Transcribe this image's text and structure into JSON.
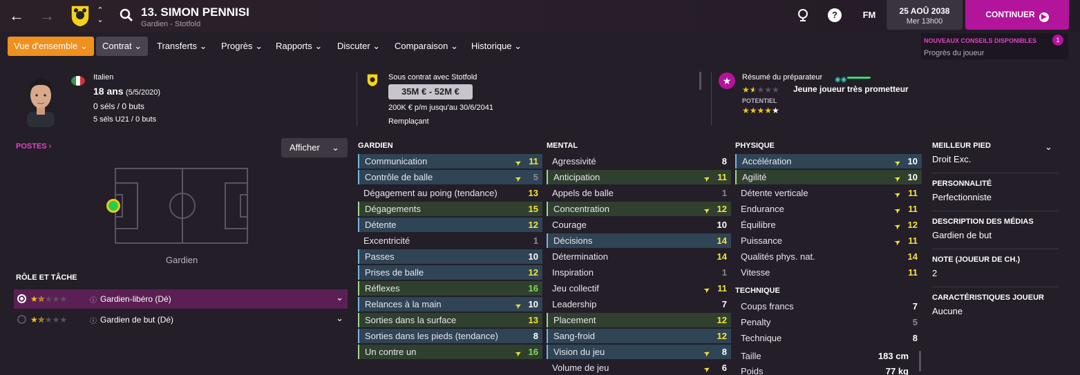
{
  "header": {
    "player_title": "13. SIMON PENNISI",
    "player_subtitle": "Gardien - Stotfold",
    "fm_label": "FM",
    "date": "25 AOÛ 2038",
    "time": "Mer 13h00",
    "continue_label": "CONTINUER"
  },
  "tabs": [
    "Vue d'ensemble",
    "Contrat",
    "Transferts",
    "Progrès",
    "Rapports",
    "Discuter",
    "Comparaison",
    "Historique"
  ],
  "advice": {
    "title": "NOUVEAUX CONSEILS DISPONIBLES",
    "subtitle": "Progrès du joueur",
    "count": "1"
  },
  "profile": {
    "nationality": "Italien",
    "age": "18 ans",
    "birth": "(5/5/2020)",
    "caps": "0 séls / 0 buts",
    "u21_caps": "5 séls U21 / 0 buts",
    "contract_label": "Sous contrat avec Stotfold",
    "value": "35M € - 52M €",
    "wage": "200K € p/m jusqu'au 30/6/2041",
    "status": "Remplaçant",
    "coach_summary": "Résumé du préparateur",
    "coach_verdict": "Jeune joueur très prometteur",
    "potential_label": "POTENTIEL",
    "current_ability_stars": 1.5,
    "potential_stars": 4
  },
  "left": {
    "postes_label": "POSTES",
    "afficher_label": "Afficher",
    "position_label": "Gardien",
    "role_title": "RÔLE ET TÂCHE",
    "roles": [
      {
        "name": "Gardien-libéro (Dé)",
        "stars": 1.5,
        "selected": true
      },
      {
        "name": "Gardien de but (Dé)",
        "stars": 1.5,
        "selected": false
      }
    ]
  },
  "attributes": {
    "gardien": {
      "title": "GARDIEN",
      "rows": [
        {
          "name": "Communication",
          "value": "11",
          "hl": "blue",
          "arrow": true,
          "color": "yel"
        },
        {
          "name": "Contrôle de balle",
          "value": "5",
          "hl": "blue",
          "arrow": true,
          "color": "gry"
        },
        {
          "name": "Dégagement au poing (tendance)",
          "value": "13",
          "hl": "",
          "arrow": false,
          "color": "yel"
        },
        {
          "name": "Dégagements",
          "value": "15",
          "hl": "green",
          "arrow": false,
          "color": "yel"
        },
        {
          "name": "Détente",
          "value": "12",
          "hl": "blue",
          "arrow": false,
          "color": "yel"
        },
        {
          "name": "Excentricité",
          "value": "1",
          "hl": "",
          "arrow": false,
          "color": "gry"
        },
        {
          "name": "Passes",
          "value": "10",
          "hl": "blue",
          "arrow": false,
          "color": "wht"
        },
        {
          "name": "Prises de balle",
          "value": "12",
          "hl": "blue",
          "arrow": false,
          "color": "yel"
        },
        {
          "name": "Réflexes",
          "value": "16",
          "hl": "green",
          "arrow": false,
          "color": "grn"
        },
        {
          "name": "Relances à la main",
          "value": "10",
          "hl": "blue",
          "arrow": true,
          "color": "wht"
        },
        {
          "name": "Sorties dans la surface",
          "value": "13",
          "hl": "green",
          "arrow": false,
          "color": "yel"
        },
        {
          "name": "Sorties dans les pieds (tendance)",
          "value": "8",
          "hl": "blue",
          "arrow": false,
          "color": "wht"
        },
        {
          "name": "Un contre un",
          "value": "16",
          "hl": "green",
          "arrow": true,
          "color": "grn"
        }
      ]
    },
    "mental": {
      "title": "MENTAL",
      "rows": [
        {
          "name": "Agressivité",
          "value": "8",
          "hl": "",
          "arrow": false,
          "color": "wht"
        },
        {
          "name": "Anticipation",
          "value": "11",
          "hl": "green",
          "arrow": true,
          "color": "yel"
        },
        {
          "name": "Appels de balle",
          "value": "1",
          "hl": "",
          "arrow": false,
          "color": "gry"
        },
        {
          "name": "Concentration",
          "value": "12",
          "hl": "green",
          "arrow": true,
          "color": "yel"
        },
        {
          "name": "Courage",
          "value": "10",
          "hl": "",
          "arrow": false,
          "color": "wht"
        },
        {
          "name": "Décisions",
          "value": "14",
          "hl": "blue",
          "arrow": false,
          "color": "yel"
        },
        {
          "name": "Détermination",
          "value": "14",
          "hl": "",
          "arrow": false,
          "color": "yel"
        },
        {
          "name": "Inspiration",
          "value": "1",
          "hl": "",
          "arrow": false,
          "color": "gry"
        },
        {
          "name": "Jeu collectif",
          "value": "11",
          "hl": "",
          "arrow": true,
          "color": "yel"
        },
        {
          "name": "Leadership",
          "value": "7",
          "hl": "",
          "arrow": false,
          "color": "wht"
        },
        {
          "name": "Placement",
          "value": "12",
          "hl": "green",
          "arrow": false,
          "color": "yel"
        },
        {
          "name": "Sang-froid",
          "value": "12",
          "hl": "blue",
          "arrow": false,
          "color": "yel"
        },
        {
          "name": "Vision du jeu",
          "value": "8",
          "hl": "blue",
          "arrow": true,
          "color": "wht"
        },
        {
          "name": "Volume de jeu",
          "value": "6",
          "hl": "",
          "arrow": true,
          "color": "wht"
        }
      ]
    },
    "physique": {
      "title": "PHYSIQUE",
      "rows": [
        {
          "name": "Accélération",
          "value": "10",
          "hl": "blue",
          "arrow": true,
          "color": "wht"
        },
        {
          "name": "Agilité",
          "value": "10",
          "hl": "green",
          "arrow": true,
          "color": "wht"
        },
        {
          "name": "Détente verticale",
          "value": "11",
          "hl": "",
          "arrow": true,
          "color": "yel"
        },
        {
          "name": "Endurance",
          "value": "11",
          "hl": "",
          "arrow": true,
          "color": "yel"
        },
        {
          "name": "Équilibre",
          "value": "12",
          "hl": "",
          "arrow": true,
          "color": "yel"
        },
        {
          "name": "Puissance",
          "value": "11",
          "hl": "",
          "arrow": true,
          "color": "yel"
        },
        {
          "name": "Qualités phys. nat.",
          "value": "14",
          "hl": "",
          "arrow": false,
          "color": "yel"
        },
        {
          "name": "Vitesse",
          "value": "11",
          "hl": "",
          "arrow": false,
          "color": "yel"
        }
      ]
    },
    "technique": {
      "title": "TECHNIQUE",
      "rows": [
        {
          "name": "Coups francs",
          "value": "7",
          "hl": "",
          "arrow": false,
          "color": "wht"
        },
        {
          "name": "Penalty",
          "value": "5",
          "hl": "",
          "arrow": false,
          "color": "gry"
        },
        {
          "name": "Technique",
          "value": "8",
          "hl": "",
          "arrow": false,
          "color": "wht"
        }
      ]
    },
    "measures": [
      {
        "name": "Taille",
        "value": "183 cm"
      },
      {
        "name": "Poids",
        "value": "77 kg"
      }
    ]
  },
  "right": [
    {
      "title": "MEILLEUR PIED",
      "value": "Droit Exc."
    },
    {
      "title": "PERSONNALITÉ",
      "value": "Perfectionniste"
    },
    {
      "title": "DESCRIPTION DES MÉDIAS",
      "value": "Gardien de but"
    },
    {
      "title": "NOTE (JOUEUR DE CH.)",
      "value": "2"
    },
    {
      "title": "CARACTÉRISTIQUES JOUEUR",
      "value": "Aucune"
    }
  ],
  "colors": {
    "accent": "#b3149c",
    "tab_active": "#f0901e",
    "attr_yellow": "#f5e63a",
    "attr_green": "#7ddc5a"
  }
}
